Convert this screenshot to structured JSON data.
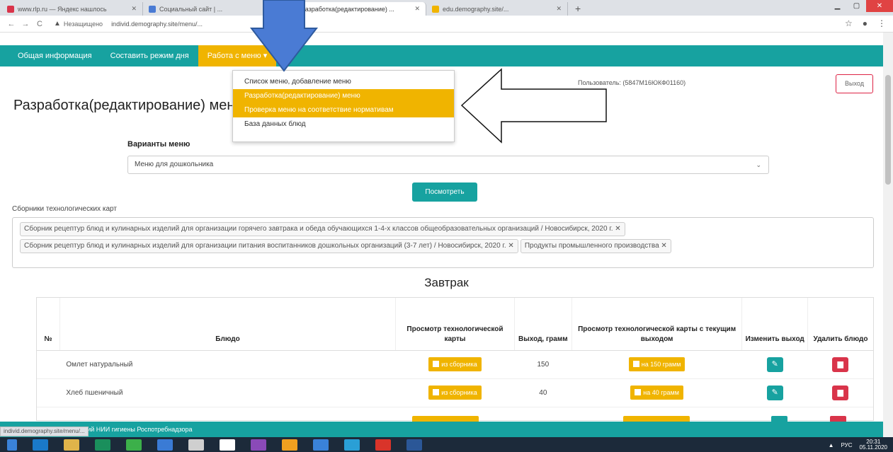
{
  "browser": {
    "tabs": [
      {
        "title": "www.rlp.ru — Яндекс нашлось",
        "color": "#d9344a",
        "active": false
      },
      {
        "title": "Социальный сайт | ...",
        "color": "#4a7bd4",
        "active": false
      },
      {
        "title": "Разработка(редактирование) ...",
        "color": "#17a2a0",
        "active": true
      },
      {
        "title": "edu.demography.site/...",
        "color": "#f0b400",
        "active": false
      }
    ],
    "new_tab": "+",
    "back": "←",
    "forward": "→",
    "reload": "C",
    "security_label": "Незащищено",
    "url": "individ.demography.site/menu/...",
    "star": "☆",
    "account": "●",
    "more": "⋮"
  },
  "nav": {
    "items": [
      {
        "label": "Общая информация"
      },
      {
        "label": "Составить режим дня"
      },
      {
        "label": "Работа с меню ▾"
      }
    ]
  },
  "dropdown": {
    "items": [
      {
        "label": "Список меню, добавление меню",
        "highlight": false
      },
      {
        "label": "Разработка(редактирование) меню",
        "highlight": true
      },
      {
        "label": "Проверка меню на соответствие нормативам",
        "highlight": true
      },
      {
        "label": "База данных блюд",
        "highlight": false
      }
    ]
  },
  "header": {
    "user": "Пользователь: (5847М16ЮКФ01160)",
    "logout": "Выход"
  },
  "page": {
    "title": "Разработка(редактирование) меню",
    "variants_label": "Варианты меню",
    "variant_selected": "Меню для дошкольника",
    "view_button": "Посмотреть",
    "collections_label": "Сборники технологических карт",
    "collections": [
      "Сборник рецептур блюд и кулинарных изделий для организации горячего завтрака и обеда обучающихся 1-4-х классов общеобразовательных организаций / Новосибирск, 2020 г. ✕",
      "Сборник рецептур блюд и кулинарных изделий для организации питания воспитанников дошкольных организаций (3-7 лет) / Новосибирск, 2020 г. ✕",
      "Продукты промышленного производства ✕"
    ],
    "section": "Завтрак"
  },
  "table": {
    "headers": [
      "№",
      "Блюдо",
      "Просмотр технологической карты",
      "Выход, грамм",
      "Просмотр технологической карты с текущим выходом",
      "Изменить выход",
      "Удалить блюдо"
    ],
    "rows": [
      {
        "num": "",
        "dish": "Омлет натуральный",
        "card_btn": "из сборника",
        "yield": "150",
        "cur_btn": "на 150 грамм"
      },
      {
        "num": "",
        "dish": "Хлеб пшеничный",
        "card_btn": "из сборника",
        "yield": "40",
        "cur_btn": "на 40 грамм"
      }
    ]
  },
  "footer": {
    "text": "© 2020 ФБУН Новосибирский НИИ гигиены Роспотребнадзора",
    "status_url": "individ.demography.site/menu/..."
  },
  "taskbar": {
    "lang": "РУС",
    "time": "20:31",
    "date": "05.11.2020",
    "icons": [
      "#3a82d8",
      "#1a79c9",
      "#e0b44a",
      "#1a8f5c",
      "#3cb04a",
      "#3a7bd5",
      "#cfcfcf",
      "#ffffff",
      "#8a4ab8",
      "#f0a020",
      "#3a82d8",
      "#2a9fd6",
      "#d9342a",
      "#2b5797"
    ]
  },
  "colors": {
    "teal": "#17a2a0",
    "amber": "#f0b400",
    "danger": "#d9344a",
    "overlay_arrow": "#4a7bd4"
  },
  "icons": {
    "pencil": "✎",
    "trash": "🗑"
  }
}
